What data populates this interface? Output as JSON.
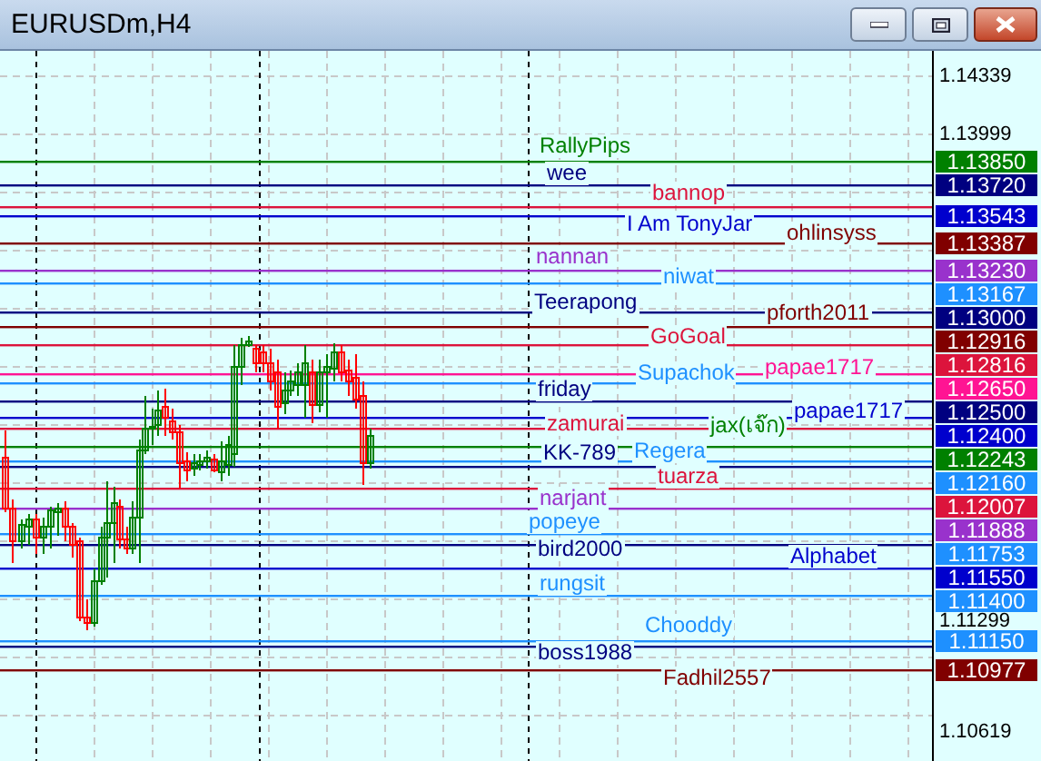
{
  "window": {
    "title": "EURUSDm,H4"
  },
  "chart": {
    "axis_ticks": [
      "1.14339",
      "1.13999",
      "1.11299",
      "1.10619"
    ],
    "levels": [
      {
        "name": "RallyPips",
        "price": "1.13850",
        "color": "#008000"
      },
      {
        "name": "wee",
        "price": "1.13720",
        "color": "#000080"
      },
      {
        "name": "bannop",
        "color": "#dc143c"
      },
      {
        "name": "I Am TonyJar",
        "price": "1.13543",
        "color": "#0000cd"
      },
      {
        "name": "ohlinsyss",
        "price": "1.13387",
        "color": "#800000"
      },
      {
        "name": "nannan",
        "price": "1.13230",
        "color": "#9932cc"
      },
      {
        "name": "niwat",
        "price": "1.13167",
        "color": "#1e90ff"
      },
      {
        "name": "Teerapong",
        "price": "1.13000",
        "color": "#000080"
      },
      {
        "name": "pforth2011",
        "price": "1.12916",
        "color": "#800000"
      },
      {
        "name": "GoGoal",
        "price": "1.12816",
        "color": "#dc143c"
      },
      {
        "name": "Supachok",
        "color": "#1e90ff"
      },
      {
        "name": "papae1717",
        "price": "1.12650",
        "color": "#ff1493"
      },
      {
        "name": "friday",
        "price": "1.12500",
        "color": "#000080"
      },
      {
        "name": "zamurai",
        "color": "#dc143c"
      },
      {
        "name": "papae1717",
        "price": "1.12400",
        "color": "#0000cd"
      },
      {
        "name": "KK-789",
        "color": "#000080"
      },
      {
        "name": "jax(เจ๊ก)",
        "price": "1.12243",
        "color": "#008000"
      },
      {
        "name": "Regera",
        "price": "1.12160",
        "color": "#1e90ff"
      },
      {
        "name": "tuarza",
        "price": "1.12007",
        "color": "#dc143c"
      },
      {
        "name": "narjant",
        "price": "1.11888",
        "color": "#9932cc"
      },
      {
        "name": "popeye",
        "price": "1.11753",
        "color": "#1e90ff"
      },
      {
        "name": "bird2000",
        "color": "#000080"
      },
      {
        "name": "Alphabet",
        "price": "1.11550",
        "color": "#0000cd"
      },
      {
        "name": "rungsit",
        "price": "1.11400",
        "color": "#1e90ff"
      },
      {
        "name": "Chooddy",
        "price": "1.11150",
        "color": "#1e90ff"
      },
      {
        "name": "boss1988",
        "color": "#000080"
      },
      {
        "name": "Fadhil2557",
        "price": "1.10977",
        "color": "#800000"
      }
    ]
  }
}
